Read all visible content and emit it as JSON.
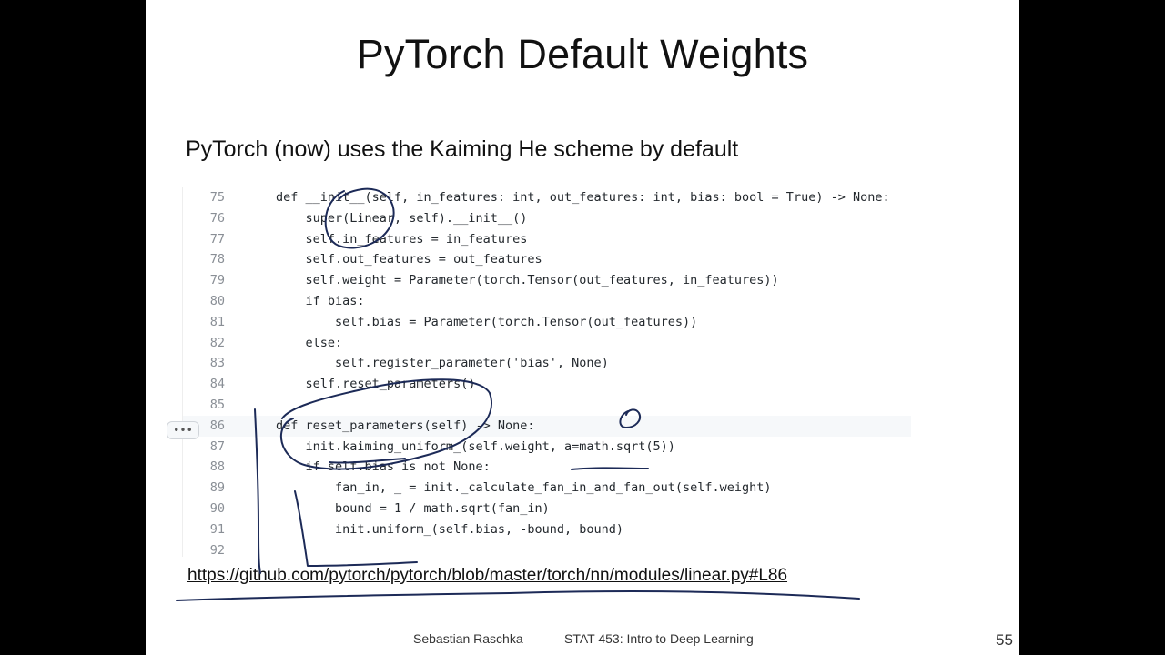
{
  "slide": {
    "title": "PyTorch Default Weights",
    "subtitle": "PyTorch (now) uses the Kaiming He scheme by default",
    "code_lines": [
      {
        "num": "75",
        "text": "def __init__(self, in_features: int, out_features: int, bias: bool = True) -> None:"
      },
      {
        "num": "76",
        "text": "    super(Linear, self).__init__()"
      },
      {
        "num": "77",
        "text": "    self.in_features = in_features"
      },
      {
        "num": "78",
        "text": "    self.out_features = out_features"
      },
      {
        "num": "79",
        "text": "    self.weight = Parameter(torch.Tensor(out_features, in_features))"
      },
      {
        "num": "80",
        "text": "    if bias:"
      },
      {
        "num": "81",
        "text": "        self.bias = Parameter(torch.Tensor(out_features))"
      },
      {
        "num": "82",
        "text": "    else:"
      },
      {
        "num": "83",
        "text": "        self.register_parameter('bias', None)"
      },
      {
        "num": "84",
        "text": "    self.reset_parameters()"
      },
      {
        "num": "85",
        "text": ""
      },
      {
        "num": "86",
        "text": "def reset_parameters(self) -> None:"
      },
      {
        "num": "87",
        "text": "    init.kaiming_uniform_(self.weight, a=math.sqrt(5))"
      },
      {
        "num": "88",
        "text": "    if self.bias is not None:"
      },
      {
        "num": "89",
        "text": "        fan_in, _ = init._calculate_fan_in_and_fan_out(self.weight)"
      },
      {
        "num": "90",
        "text": "        bound = 1 / math.sqrt(fan_in)"
      },
      {
        "num": "91",
        "text": "        init.uniform_(self.bias, -bound, bound)"
      },
      {
        "num": "92",
        "text": ""
      }
    ],
    "ellipsis_label": "•••",
    "link": "https://github.com/pytorch/pytorch/blob/master/torch/nn/modules/linear.py#L86",
    "footer": {
      "author": "Sebastian Raschka",
      "course": "STAT 453: Intro to Deep Learning",
      "page": "55"
    }
  }
}
